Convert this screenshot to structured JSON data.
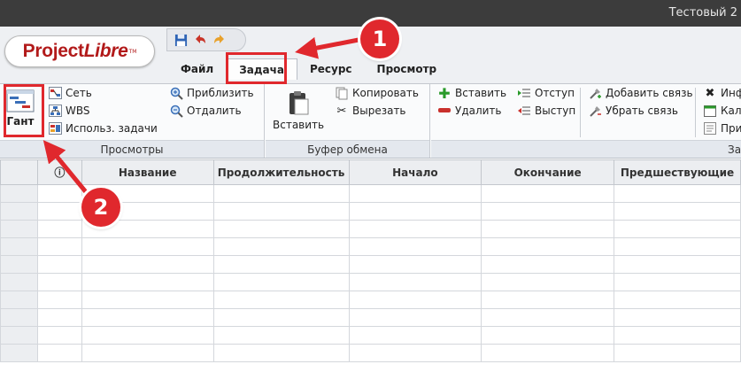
{
  "window": {
    "title": "Тестовый 2"
  },
  "logo": {
    "text_a": "Project",
    "text_b": "Libre",
    "tm": "TM"
  },
  "quick_access": [
    {
      "icon": "save-icon",
      "glyph": "💾"
    },
    {
      "icon": "undo-icon",
      "glyph": "↶"
    },
    {
      "icon": "redo-icon",
      "glyph": "↷"
    }
  ],
  "tabs": [
    "Файл",
    "Задача",
    "Ресурс",
    "Просмотр"
  ],
  "active_tab": "Задача",
  "ribbon": {
    "views": {
      "label": "Просмотры",
      "gantt": "Гант",
      "network": "Сеть",
      "wbs": "WBS",
      "task_usage": "Использ. задачи",
      "zoom_in": "Приблизить",
      "zoom_out": "Отдалить"
    },
    "clipboard": {
      "label": "Буфер обмена",
      "paste": "Вставить",
      "copy": "Копировать",
      "cut": "Вырезать"
    },
    "tasks": {
      "label": "Зад",
      "insert": "Вставить",
      "delete": "Удалить",
      "indent": "Отступ",
      "outdent": "Выступ",
      "link": "Добавить связь",
      "unlink": "Убрать связь",
      "info": "Инф",
      "calendar": "Кал",
      "note": "При"
    }
  },
  "grid": {
    "columns": [
      "",
      "ⓘ",
      "Название",
      "Продолжительность",
      "Начало",
      "Окончание",
      "Предшествующие"
    ],
    "row_count": 10
  },
  "callouts": {
    "one": "1",
    "two": "2"
  },
  "colors": {
    "highlight": "#e0282d",
    "logo": "#b21a1a"
  }
}
